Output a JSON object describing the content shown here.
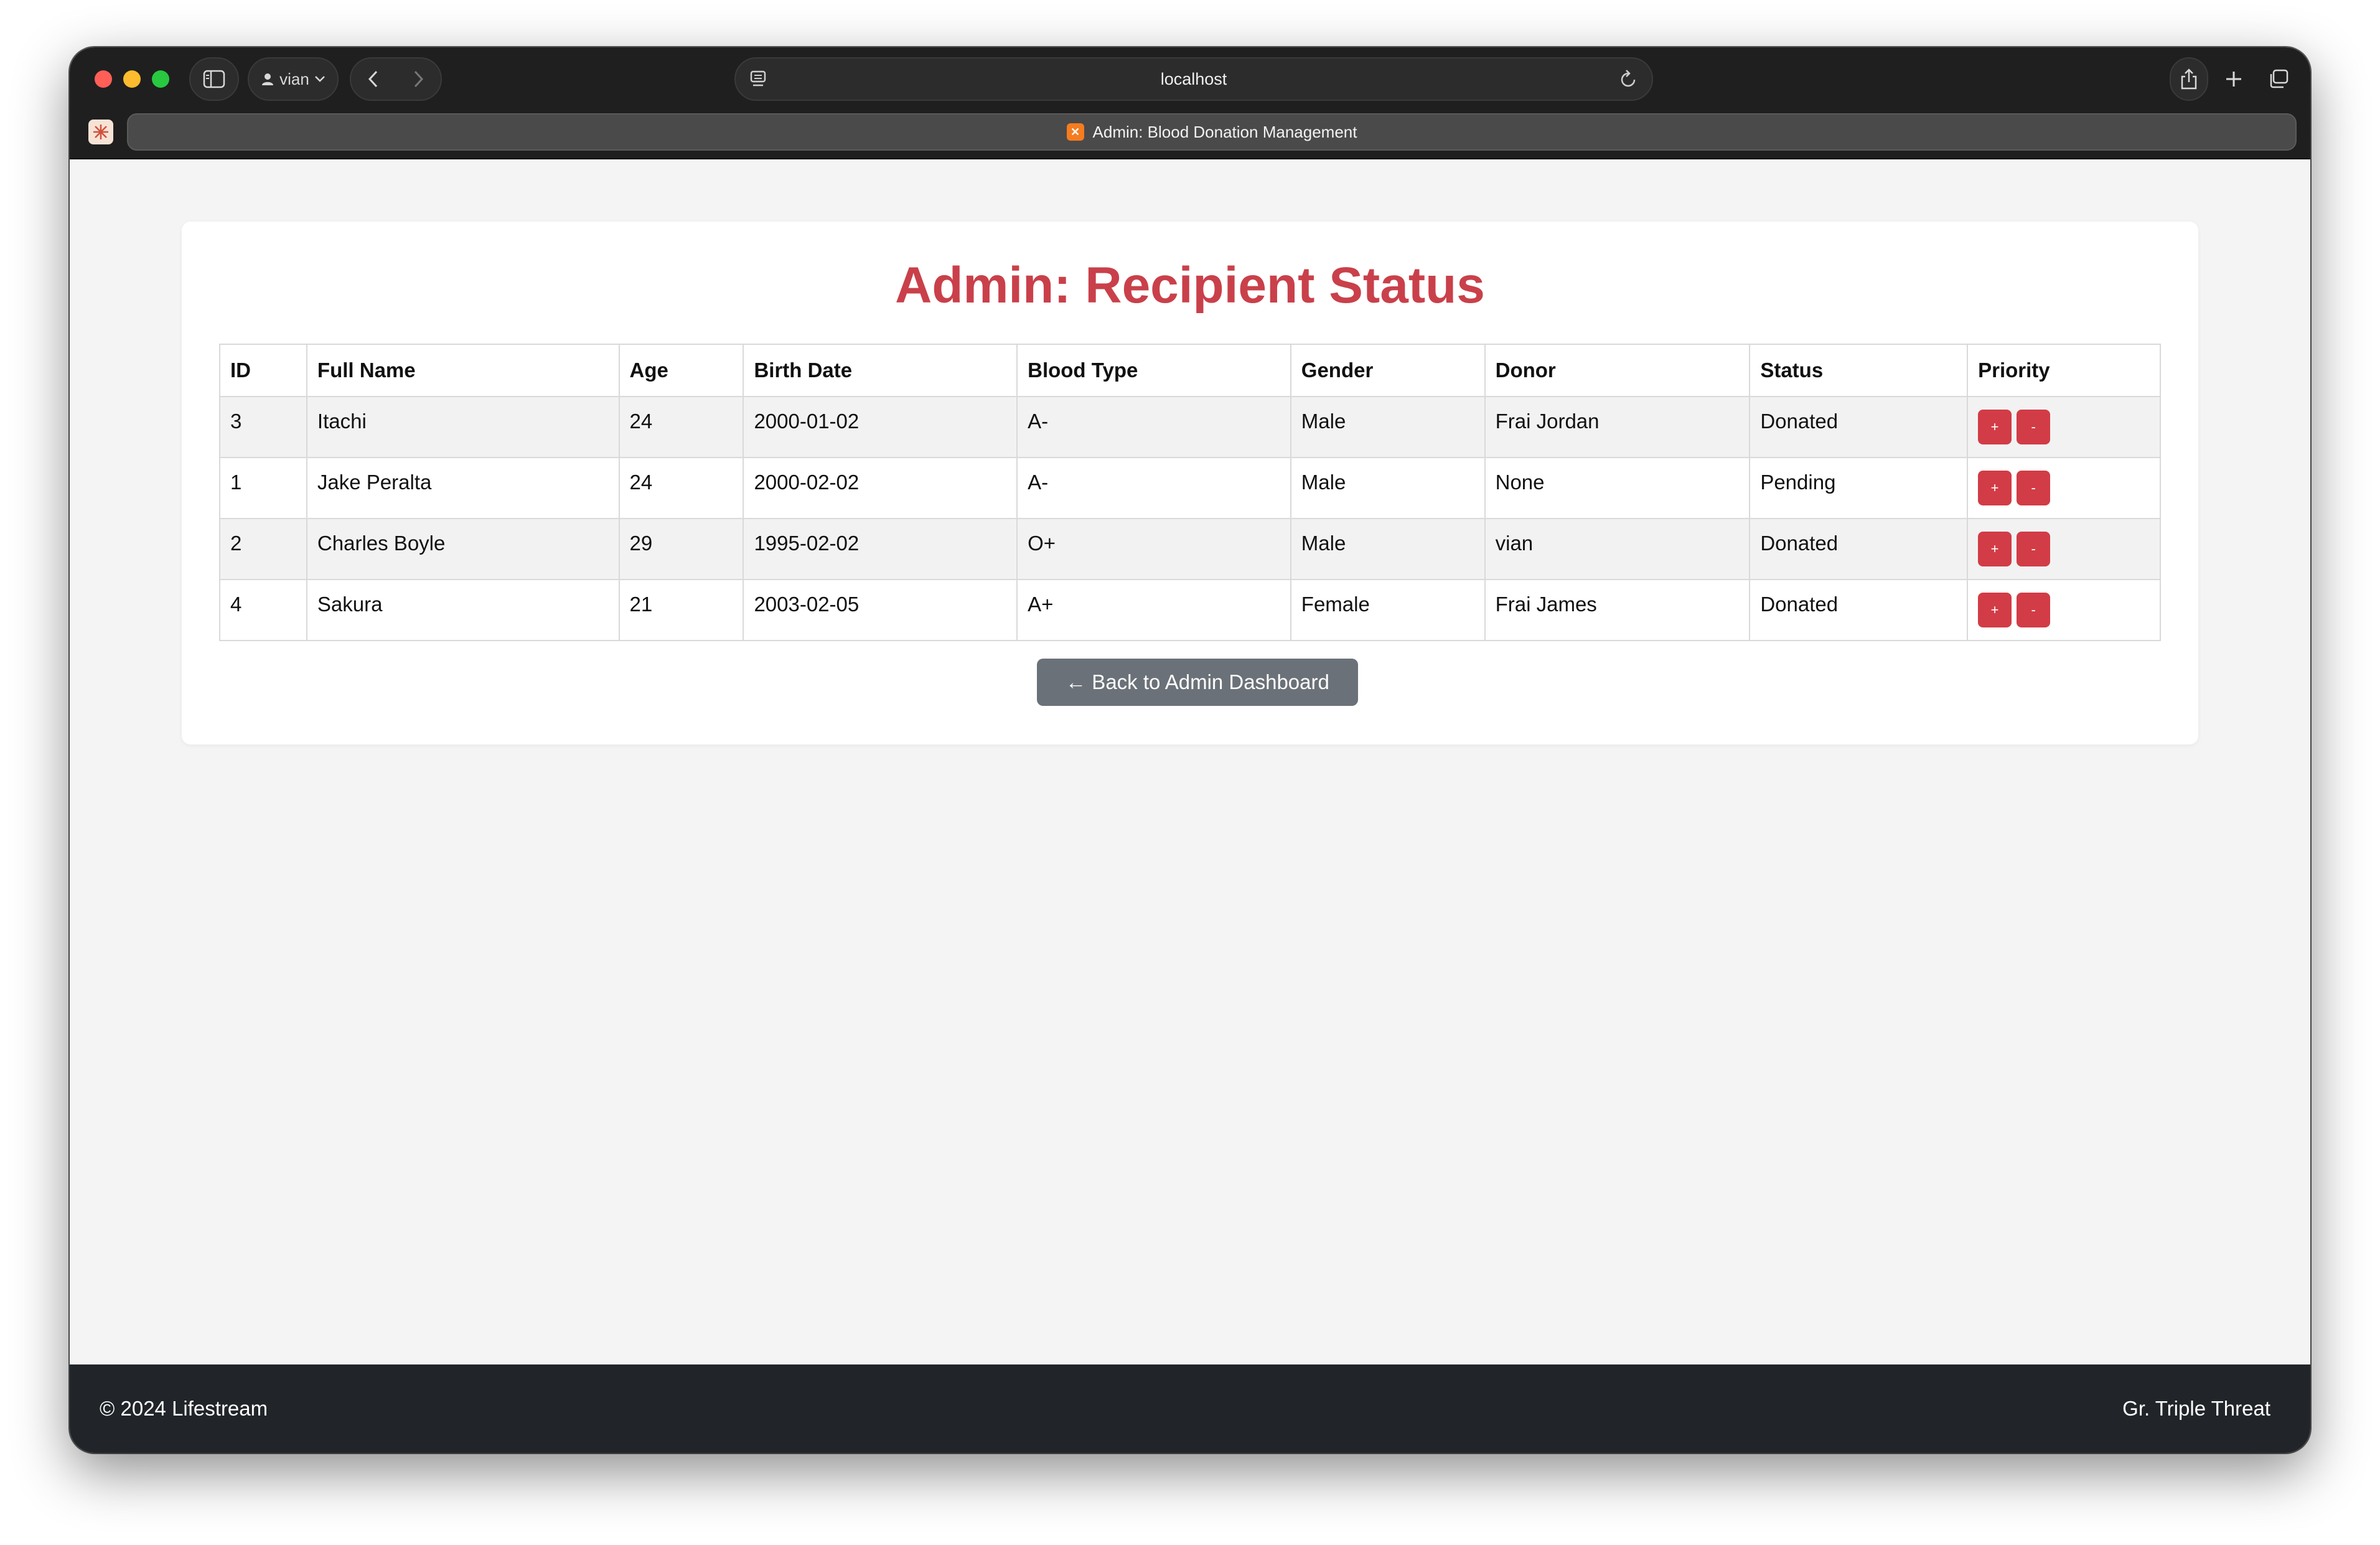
{
  "browser": {
    "profile_name": "vian",
    "url": "localhost",
    "tab_title": "Admin: Blood Donation Management"
  },
  "page": {
    "title": "Admin: Recipient Status",
    "back_button_label": "← Back to Admin Dashboard"
  },
  "table": {
    "headers": [
      "ID",
      "Full Name",
      "Age",
      "Birth Date",
      "Blood Type",
      "Gender",
      "Donor",
      "Status",
      "Priority"
    ],
    "rows": [
      {
        "id": "3",
        "full_name": "Itachi",
        "age": "24",
        "birth_date": "2000-01-02",
        "blood_type": "A-",
        "gender": "Male",
        "donor": "Frai Jordan",
        "status": "Donated"
      },
      {
        "id": "1",
        "full_name": "Jake Peralta",
        "age": "24",
        "birth_date": "2000-02-02",
        "blood_type": "A-",
        "gender": "Male",
        "donor": "None",
        "status": "Pending"
      },
      {
        "id": "2",
        "full_name": "Charles Boyle",
        "age": "29",
        "birth_date": "1995-02-02",
        "blood_type": "O+",
        "gender": "Male",
        "donor": "vian",
        "status": "Donated"
      },
      {
        "id": "4",
        "full_name": "Sakura",
        "age": "21",
        "birth_date": "2003-02-05",
        "blood_type": "A+",
        "gender": "Female",
        "donor": "Frai James",
        "status": "Donated"
      }
    ],
    "priority_increase_label": "+",
    "priority_decrease_label": "-"
  },
  "footer": {
    "copyright": "© 2024 Lifestream",
    "credit": "Gr. Triple Threat"
  },
  "colors": {
    "accent_red": "#c9404a",
    "priority_button": "#d23c46",
    "back_button": "#6b7178",
    "footer_bg": "#212529"
  }
}
